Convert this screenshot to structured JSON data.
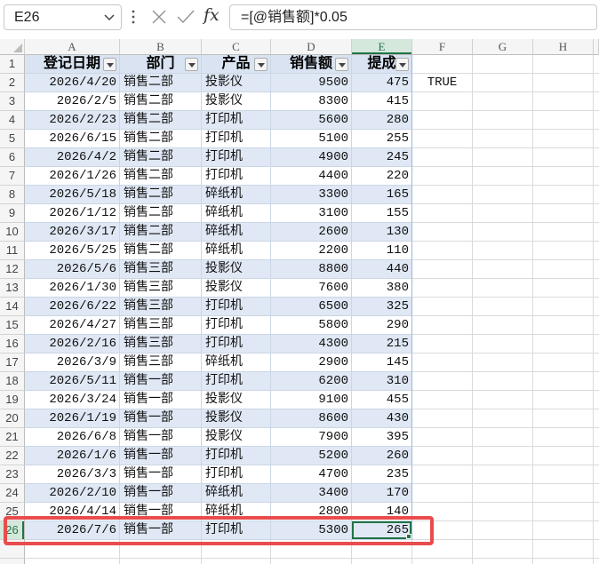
{
  "formula_bar": {
    "name_box": "E26",
    "name_box_icon": "chevron-down-icon",
    "more_icon": "vertical-dots-icon",
    "cancel_icon": "close-icon",
    "enter_icon": "check-icon",
    "fx_label": "fx",
    "formula": "=[@销售额]*0.05"
  },
  "sheet": {
    "column_letters": [
      "A",
      "B",
      "C",
      "D",
      "E",
      "F",
      "G",
      "H"
    ],
    "row_numbers": [
      "1",
      "2",
      "3",
      "4",
      "5",
      "6",
      "7",
      "8",
      "9",
      "10",
      "11",
      "12",
      "13",
      "14",
      "15",
      "16",
      "17",
      "18",
      "19",
      "20",
      "21",
      "22",
      "23",
      "24",
      "25",
      "26"
    ],
    "table": {
      "headers": [
        "登记日期",
        "部门",
        "产品",
        "销售额",
        "提成"
      ],
      "filter_icon": "triangle-down-icon",
      "rows": [
        {
          "date": "2026/4/20",
          "dept": "销售二部",
          "product": "投影仪",
          "sales": 9500,
          "commission": 475
        },
        {
          "date": "2026/2/5",
          "dept": "销售二部",
          "product": "投影仪",
          "sales": 8300,
          "commission": 415
        },
        {
          "date": "2026/2/23",
          "dept": "销售二部",
          "product": "打印机",
          "sales": 5600,
          "commission": 280
        },
        {
          "date": "2026/6/15",
          "dept": "销售二部",
          "product": "打印机",
          "sales": 5100,
          "commission": 255
        },
        {
          "date": "2026/4/2",
          "dept": "销售二部",
          "product": "打印机",
          "sales": 4900,
          "commission": 245
        },
        {
          "date": "2026/1/26",
          "dept": "销售二部",
          "product": "打印机",
          "sales": 4400,
          "commission": 220
        },
        {
          "date": "2026/5/18",
          "dept": "销售二部",
          "product": "碎纸机",
          "sales": 3300,
          "commission": 165
        },
        {
          "date": "2026/1/12",
          "dept": "销售二部",
          "product": "碎纸机",
          "sales": 3100,
          "commission": 155
        },
        {
          "date": "2026/3/17",
          "dept": "销售二部",
          "product": "碎纸机",
          "sales": 2600,
          "commission": 130
        },
        {
          "date": "2026/5/25",
          "dept": "销售二部",
          "product": "碎纸机",
          "sales": 2200,
          "commission": 110
        },
        {
          "date": "2026/5/6",
          "dept": "销售三部",
          "product": "投影仪",
          "sales": 8800,
          "commission": 440
        },
        {
          "date": "2026/1/30",
          "dept": "销售三部",
          "product": "投影仪",
          "sales": 7600,
          "commission": 380
        },
        {
          "date": "2026/6/22",
          "dept": "销售三部",
          "product": "打印机",
          "sales": 6500,
          "commission": 325
        },
        {
          "date": "2026/4/27",
          "dept": "销售三部",
          "product": "打印机",
          "sales": 5800,
          "commission": 290
        },
        {
          "date": "2026/2/16",
          "dept": "销售三部",
          "product": "打印机",
          "sales": 4300,
          "commission": 215
        },
        {
          "date": "2026/3/9",
          "dept": "销售三部",
          "product": "碎纸机",
          "sales": 2900,
          "commission": 145
        },
        {
          "date": "2026/5/11",
          "dept": "销售一部",
          "product": "打印机",
          "sales": 6200,
          "commission": 310
        },
        {
          "date": "2026/3/24",
          "dept": "销售一部",
          "product": "投影仪",
          "sales": 9100,
          "commission": 455
        },
        {
          "date": "2026/1/19",
          "dept": "销售一部",
          "product": "投影仪",
          "sales": 8600,
          "commission": 430
        },
        {
          "date": "2026/6/8",
          "dept": "销售一部",
          "product": "投影仪",
          "sales": 7900,
          "commission": 395
        },
        {
          "date": "2026/1/6",
          "dept": "销售一部",
          "product": "打印机",
          "sales": 5200,
          "commission": 260
        },
        {
          "date": "2026/3/3",
          "dept": "销售一部",
          "product": "打印机",
          "sales": 4700,
          "commission": 235
        },
        {
          "date": "2026/2/10",
          "dept": "销售一部",
          "product": "碎纸机",
          "sales": 3400,
          "commission": 170
        },
        {
          "date": "2026/4/14",
          "dept": "销售一部",
          "product": "碎纸机",
          "sales": 2800,
          "commission": 140
        },
        {
          "date": "2026/7/6",
          "dept": "销售一部",
          "product": "打印机",
          "sales": 5300,
          "commission": 265
        }
      ]
    },
    "cells": {
      "F2": "TRUE"
    }
  },
  "colors": {
    "accent_green": "#217346",
    "table_header_fill": "#d9e3f2",
    "table_band_fill": "#dfe8f4",
    "annotation_red": "#e94c4c"
  }
}
